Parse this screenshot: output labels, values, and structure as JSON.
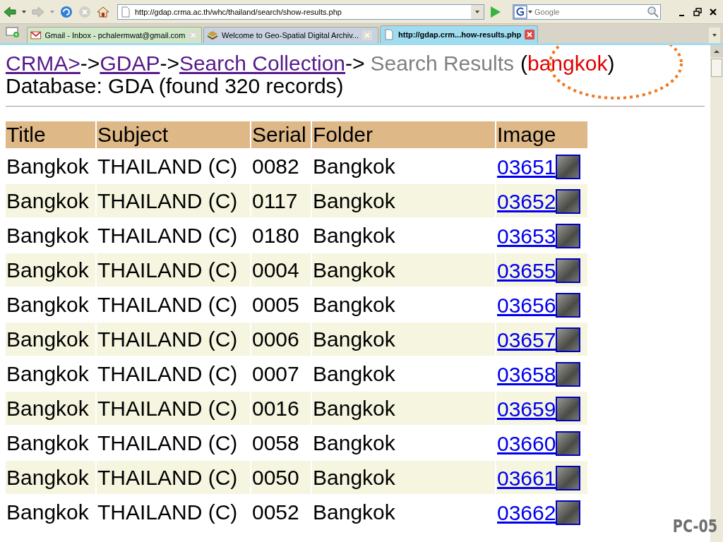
{
  "browser": {
    "address": "http://gdap.crma.ac.th/whc/thailand/search/show-results.php",
    "search_placeholder": "Google",
    "tabs": [
      {
        "label": "Gmail - Inbox - pchalermwat@gmail.com",
        "kind": "mail",
        "selected": false
      },
      {
        "label": "Welcome to Geo-Spatial Digital Archiv...",
        "kind": "layers",
        "selected": false
      },
      {
        "label": "http://gdap.crm...how-results.php",
        "kind": "page",
        "selected": true
      }
    ]
  },
  "breadcrumb": [
    {
      "kind": "link",
      "text": "CRMA>"
    },
    {
      "kind": "separator",
      "text": "->"
    },
    {
      "kind": "link",
      "text": "GDAP"
    },
    {
      "kind": "separator",
      "text": "->"
    },
    {
      "kind": "link",
      "text": "Search Collection"
    },
    {
      "kind": "separator",
      "text": "->"
    },
    {
      "kind": "current",
      "text": "Search Results"
    },
    {
      "kind": "paren",
      "text": "("
    },
    {
      "kind": "query",
      "text": "bangkok"
    },
    {
      "kind": "paren",
      "text": ")"
    }
  ],
  "summary": "Database: GDA (found 320 records)",
  "table": {
    "columns": [
      "Title",
      "Subject",
      "Serial",
      "Folder",
      "Image"
    ],
    "rows": [
      {
        "title": "Bangkok",
        "subject": "THAILAND (C)",
        "serial": "0082",
        "folder": "Bangkok",
        "image": "03651"
      },
      {
        "title": "Bangkok",
        "subject": "THAILAND (C)",
        "serial": "0117",
        "folder": "Bangkok",
        "image": "03652"
      },
      {
        "title": "Bangkok",
        "subject": "THAILAND (C)",
        "serial": "0180",
        "folder": "Bangkok",
        "image": "03653"
      },
      {
        "title": "Bangkok",
        "subject": "THAILAND (C)",
        "serial": "0004",
        "folder": "Bangkok",
        "image": "03655"
      },
      {
        "title": "Bangkok",
        "subject": "THAILAND (C)",
        "serial": "0005",
        "folder": "Bangkok",
        "image": "03656"
      },
      {
        "title": "Bangkok",
        "subject": "THAILAND (C)",
        "serial": "0006",
        "folder": "Bangkok",
        "image": "03657"
      },
      {
        "title": "Bangkok",
        "subject": "THAILAND (C)",
        "serial": "0007",
        "folder": "Bangkok",
        "image": "03658"
      },
      {
        "title": "Bangkok",
        "subject": "THAILAND (C)",
        "serial": "0016",
        "folder": "Bangkok",
        "image": "03659"
      },
      {
        "title": "Bangkok",
        "subject": "THAILAND (C)",
        "serial": "0058",
        "folder": "Bangkok",
        "image": "03660"
      },
      {
        "title": "Bangkok",
        "subject": "THAILAND (C)",
        "serial": "0050",
        "folder": "Bangkok",
        "image": "03661"
      },
      {
        "title": "Bangkok",
        "subject": "THAILAND (C)",
        "serial": "0052",
        "folder": "Bangkok",
        "image": "03662"
      }
    ]
  },
  "figure_label": "PC-05"
}
